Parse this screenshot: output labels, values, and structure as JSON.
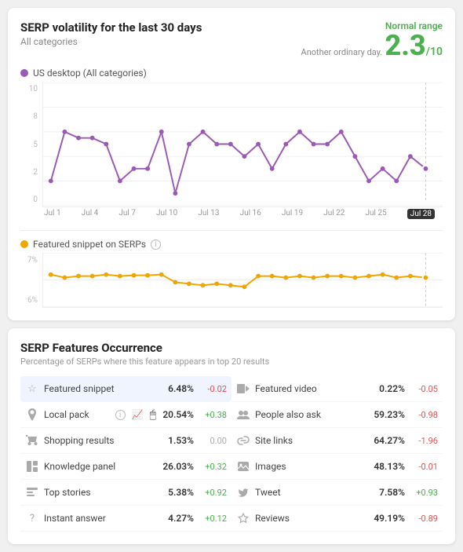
{
  "page": {
    "card1": {
      "title": "SERP volatility for the last 30 days",
      "subtitle": "All categories",
      "range_label": "Normal range",
      "ordinary_day": "Another ordinary day.",
      "score": "2.3",
      "score_denom": "/10"
    },
    "chart1": {
      "label": "US desktop (All categories)",
      "y_labels": [
        "10",
        "8",
        "5",
        "2",
        "0"
      ],
      "x_labels": [
        "Jul 1",
        "Jul 4",
        "Jul 7",
        "Jul 10",
        "Jul 13",
        "Jul 16",
        "Jul 19",
        "Jul 22",
        "Jul 25",
        "Jul 28"
      ]
    },
    "chart2": {
      "label": "Featured snippet on SERPs",
      "y_labels": [
        "7%",
        "6%"
      ]
    },
    "features": {
      "title": "SERP Features Occurrence",
      "subtitle": "Percentage of SERPs where this feature appears in top 20 results",
      "left": [
        {
          "icon": "star",
          "name": "Featured snippet",
          "pct": "6.48%",
          "delta": "-0.02",
          "highlighted": true
        },
        {
          "icon": "pin",
          "name": "Local pack",
          "pct": "20.54%",
          "delta": "+0.38",
          "has_info": true,
          "has_trend": true
        },
        {
          "icon": "cart",
          "name": "Shopping results",
          "pct": "1.53%",
          "delta": "0.00"
        },
        {
          "icon": "panel",
          "name": "Knowledge panel",
          "pct": "26.03%",
          "delta": "+0.32"
        },
        {
          "icon": "news",
          "name": "Top stories",
          "pct": "5.38%",
          "delta": "+0.92"
        },
        {
          "icon": "question",
          "name": "Instant answer",
          "pct": "4.27%",
          "delta": "+0.12"
        }
      ],
      "right": [
        {
          "icon": "video",
          "name": "Featured video",
          "pct": "0.22%",
          "delta": "-0.05"
        },
        {
          "icon": "people",
          "name": "People also ask",
          "pct": "59.23%",
          "delta": "-0.98"
        },
        {
          "icon": "link",
          "name": "Site links",
          "pct": "64.27%",
          "delta": "-1.96"
        },
        {
          "icon": "image",
          "name": "Images",
          "pct": "48.13%",
          "delta": "-0.01"
        },
        {
          "icon": "twitter",
          "name": "Tweet",
          "pct": "7.58%",
          "delta": "+0.93"
        },
        {
          "icon": "star-o",
          "name": "Reviews",
          "pct": "49.19%",
          "delta": "-0.89"
        }
      ]
    }
  }
}
